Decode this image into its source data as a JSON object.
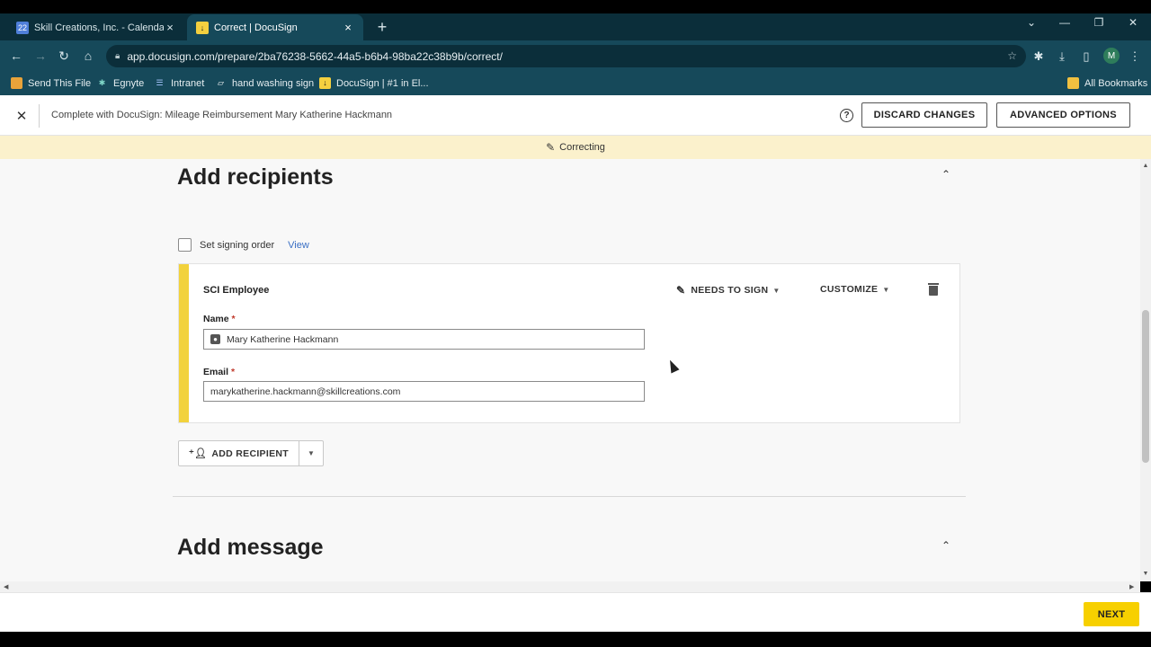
{
  "browser": {
    "tabs": [
      {
        "title": "Skill Creations, Inc. - Calendar - S",
        "favicon": "calendar-icon",
        "favicon_text": "22"
      },
      {
        "title": "Correct | DocuSign",
        "favicon": "docusign-icon",
        "favicon_text": "↓"
      }
    ],
    "url": "app.docusign.com/prepare/2ba76238-5662-44a5-b6b4-98ba22c38b9b/correct/",
    "profile_initial": "M",
    "bookmarks": [
      {
        "label": "Send This File"
      },
      {
        "label": "Egnyte"
      },
      {
        "label": "Intranet"
      },
      {
        "label": "hand washing sign"
      },
      {
        "label": "DocuSign | #1 in El..."
      }
    ],
    "all_bookmarks": "All Bookmarks"
  },
  "header": {
    "title": "Complete with DocuSign: Mileage Reimbursement Mary Katherine Hackmann",
    "help": "?",
    "discard_label": "DISCARD CHANGES",
    "advanced_label": "ADVANCED OPTIONS"
  },
  "banner": {
    "text": "Correcting"
  },
  "recipients": {
    "title": "Add recipients",
    "signing_order_label": "Set signing order",
    "view_link": "View",
    "card": {
      "role": "SCI Employee",
      "action": "NEEDS TO SIGN",
      "customize": "CUSTOMIZE",
      "name_label": "Name",
      "name_value": "Mary Katherine Hackmann",
      "email_label": "Email",
      "email_value": "marykatherine.hackmann@skillcreations.com",
      "required_mark": "*"
    },
    "add_button": "ADD RECIPIENT"
  },
  "message": {
    "title": "Add message"
  },
  "footer": {
    "next_label": "NEXT"
  },
  "colors": {
    "accent_yellow": "#f2d23c",
    "banner_bg": "#fbf1cc",
    "next_btn": "#f7d000",
    "chrome_dark": "#0b2e3a",
    "chrome_mid": "#16495a",
    "link_blue": "#3a6fc4"
  }
}
